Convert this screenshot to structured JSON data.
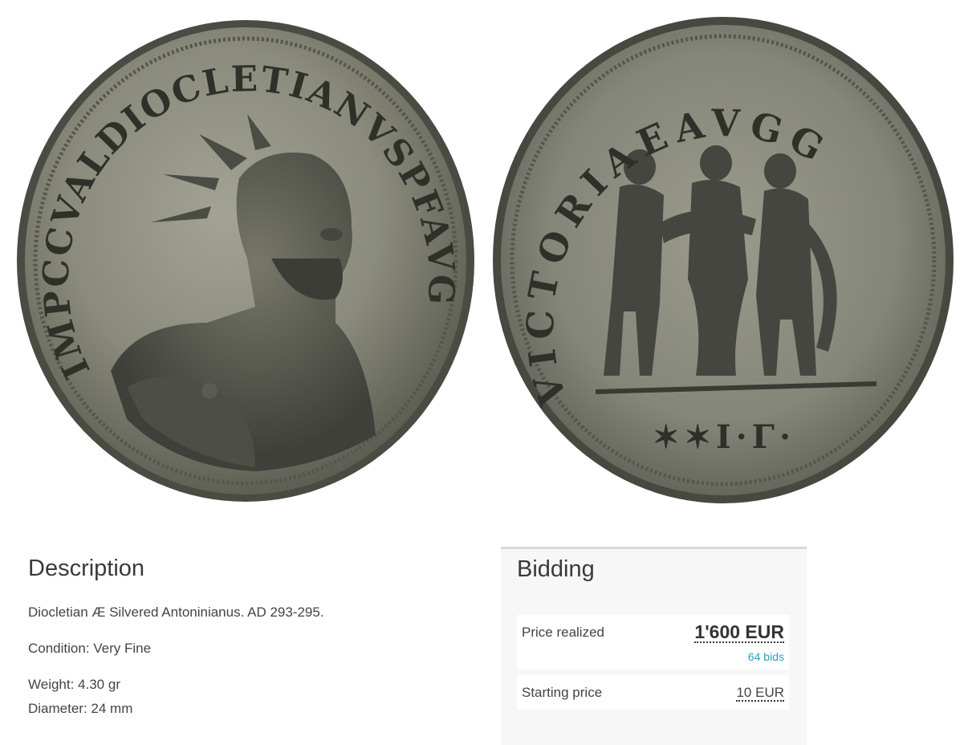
{
  "images": {
    "obverse_legend": "IMPCCVALDIOCLETIANVSPFAVG",
    "reverse_legend": "VICTORIAEAVGG",
    "reverse_exergue": "✶✶I·Γ·"
  },
  "description": {
    "heading": "Description",
    "title": "Diocletian Æ Silvered Antoninianus. AD 293-295.",
    "condition": "Condition: Very Fine",
    "weight": "Weight: 4.30 gr",
    "diameter": "Diameter: 24 mm"
  },
  "bidding": {
    "heading": "Bidding",
    "price_realized_label": "Price realized",
    "price_realized_value": "1'600 EUR",
    "bids_count": "64 bids",
    "starting_price_label": "Starting price",
    "starting_price_value": "10 EUR"
  },
  "colors": {
    "coin_metal": "#8e8f80",
    "accent_link": "#2aa3b5",
    "panel_bg": "#f7f7f7"
  }
}
